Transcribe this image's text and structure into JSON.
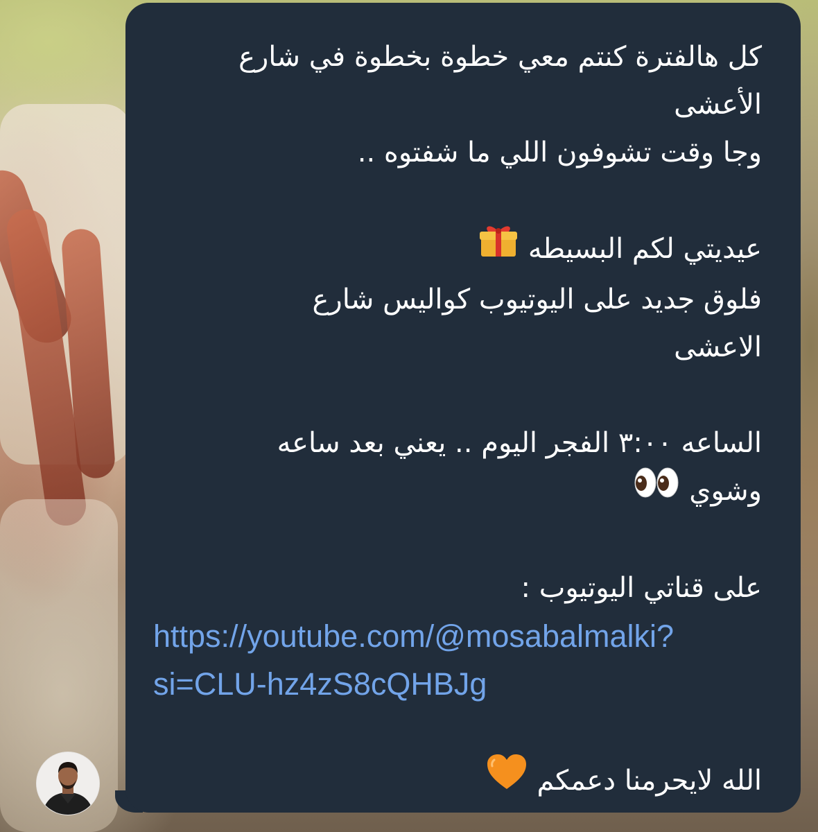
{
  "message": {
    "lines": [
      "كل هالفترة كنتم معي خطوة بخطوة في شارع",
      "الأعشى",
      "وجا وقت تشوفون اللي ما شفتوه ..",
      "عيديتي لكم البسيطه",
      "فلوق جديد على اليوتيوب كواليس شارع",
      "الاعشى",
      "الساعه ٣:٠٠ الفجر اليوم .. يعني بعد ساعه",
      "وشوي",
      "على قناتي اليوتيوب :",
      "الله لايحرمنا دعمكم"
    ],
    "link_line1": "https://youtube.com/@mosabalmalki?",
    "link_line2": "si=CLU-hz4zS8cQHBJg",
    "link_href": "https://youtube.com/@mosabalmalki?si=CLU-hz4zS8cQHBJg"
  },
  "icons": {
    "gift": "gift-emoji",
    "eyes": "eyes-emoji",
    "heart": "orange-heart-emoji",
    "avatar": "sender-avatar"
  },
  "colors": {
    "bubble": "#212d3b",
    "text": "#ffffff",
    "link": "#72a4e9"
  }
}
